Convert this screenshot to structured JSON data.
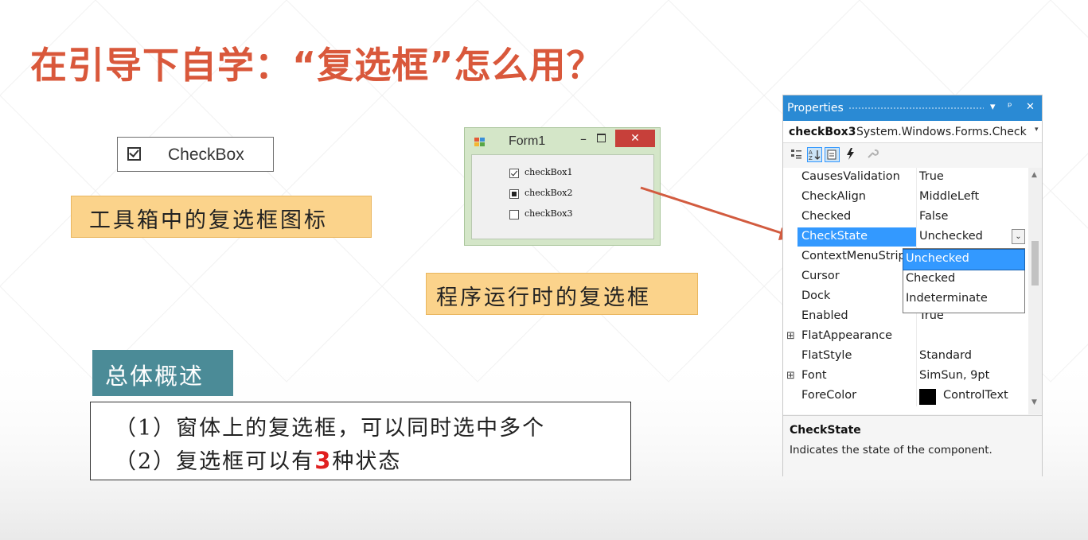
{
  "slide": {
    "title": "在引导下自学：“复选框”怎么用？",
    "accent_color": "#d9583b"
  },
  "toolbox": {
    "item_label": "CheckBox",
    "caption": "工具箱中的复选框图标"
  },
  "form1": {
    "title": "Form1",
    "close_symbol": "✕",
    "minimize_symbol": "–",
    "checkboxes": [
      {
        "label": "checkBox1",
        "state": "checked"
      },
      {
        "label": "checkBox2",
        "state": "indeterminate"
      },
      {
        "label": "checkBox3",
        "state": "unchecked"
      }
    ],
    "caption": "程序运行时的复选框"
  },
  "properties": {
    "header_title": "Properties",
    "header_controls": [
      "▾",
      "ᵖ",
      "✕"
    ],
    "object_name": "checkBox3",
    "object_type": "System.Windows.Forms.Check",
    "rows": [
      {
        "name": "CausesValidation",
        "value": "True"
      },
      {
        "name": "CheckAlign",
        "value": "MiddleLeft"
      },
      {
        "name": "Checked",
        "value": "False"
      },
      {
        "name": "CheckState",
        "value": "Unchecked"
      },
      {
        "name": "ContextMenuStrip",
        "value": ""
      },
      {
        "name": "Cursor",
        "value": ""
      },
      {
        "name": "Dock",
        "value": ""
      },
      {
        "name": "Enabled",
        "value": "True"
      },
      {
        "name": "FlatAppearance",
        "value": ""
      },
      {
        "name": "FlatStyle",
        "value": "Standard"
      },
      {
        "name": "Font",
        "value": "SimSun, 9pt"
      },
      {
        "name": "ForeColor",
        "value": "ControlText"
      }
    ],
    "dropdown_options": [
      "Unchecked",
      "Checked",
      "Indeterminate"
    ],
    "description_title": "CheckState",
    "description_text": "Indicates the state of the component."
  },
  "overview": {
    "title": "总体概述",
    "line1": "（1）窗体上的复选框，可以同时选中多个",
    "line2_prefix": "（2）复选框可以有",
    "line2_number": "3",
    "line2_suffix": "种状态"
  }
}
